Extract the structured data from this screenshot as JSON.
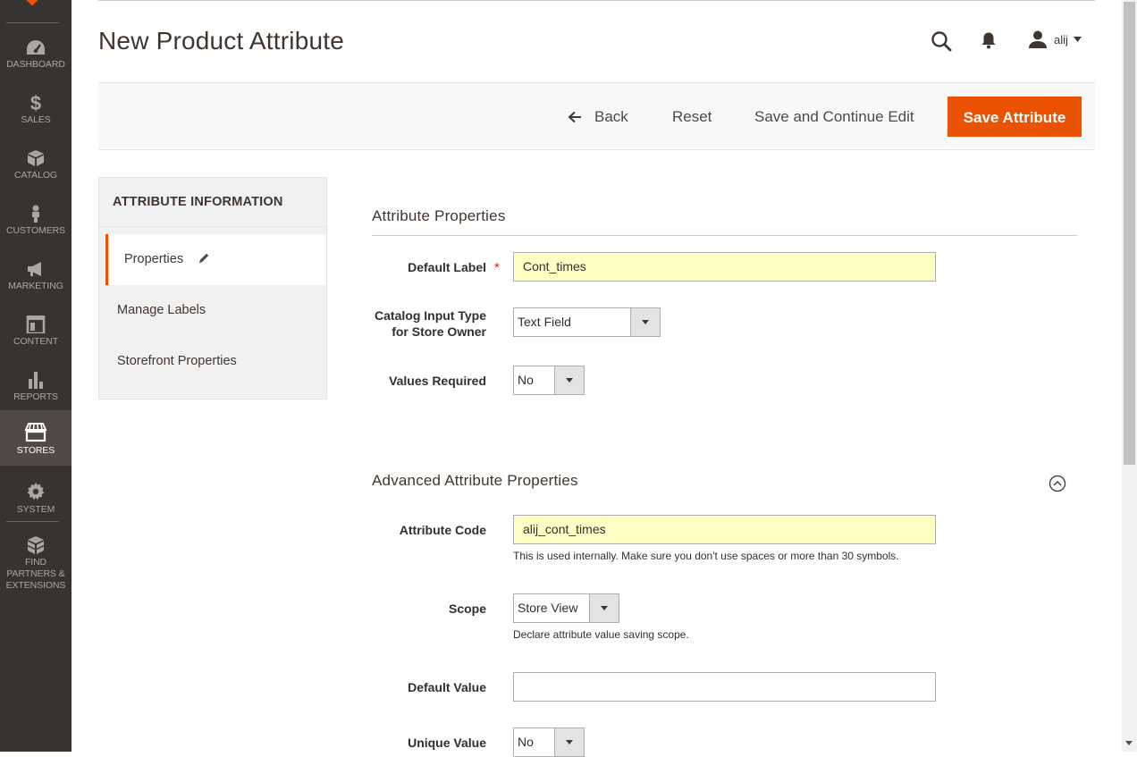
{
  "sidebar": {
    "items": [
      {
        "label": "DASHBOARD",
        "icon": "dashboard-icon"
      },
      {
        "label": "SALES",
        "icon": "dollar-icon"
      },
      {
        "label": "CATALOG",
        "icon": "cube-icon"
      },
      {
        "label": "CUSTOMERS",
        "icon": "person-icon"
      },
      {
        "label": "MARKETING",
        "icon": "megaphone-icon"
      },
      {
        "label": "CONTENT",
        "icon": "layout-icon"
      },
      {
        "label": "REPORTS",
        "icon": "bar-chart-icon"
      },
      {
        "label": "STORES",
        "icon": "storefront-icon",
        "active": true
      },
      {
        "label": "SYSTEM",
        "icon": "gear-icon"
      },
      {
        "label": "FIND PARTNERS & EXTENSIONS",
        "icon": "boxes-icon"
      }
    ]
  },
  "header": {
    "title": "New Product Attribute",
    "user": "alij"
  },
  "actions": {
    "back": "Back",
    "reset": "Reset",
    "save_continue": "Save and Continue Edit",
    "save": "Save Attribute"
  },
  "tabs": {
    "title": "ATTRIBUTE INFORMATION",
    "items": [
      "Properties",
      "Manage Labels",
      "Storefront Properties"
    ]
  },
  "properties": {
    "title": "Attribute Properties",
    "default_label": {
      "label": "Default Label",
      "value": "Cont_times",
      "required": true
    },
    "input_type": {
      "label": "Catalog Input Type for Store Owner",
      "value": "Text Field"
    },
    "values_required": {
      "label": "Values Required",
      "value": "No"
    }
  },
  "advanced": {
    "title": "Advanced Attribute Properties",
    "attribute_code": {
      "label": "Attribute Code",
      "value": "alij_cont_times",
      "note": "This is used internally. Make sure you don't use spaces or more than 30 symbols."
    },
    "scope": {
      "label": "Scope",
      "value": "Store View",
      "note": "Declare attribute value saving scope."
    },
    "default_value": {
      "label": "Default Value",
      "value": ""
    },
    "unique_value": {
      "label": "Unique Value",
      "value": "No"
    }
  },
  "colors": {
    "accent": "#eb5202",
    "sidebar_bg": "#373330",
    "sidebar_active": "#514943",
    "autofill_bg": "#ffffc3"
  }
}
